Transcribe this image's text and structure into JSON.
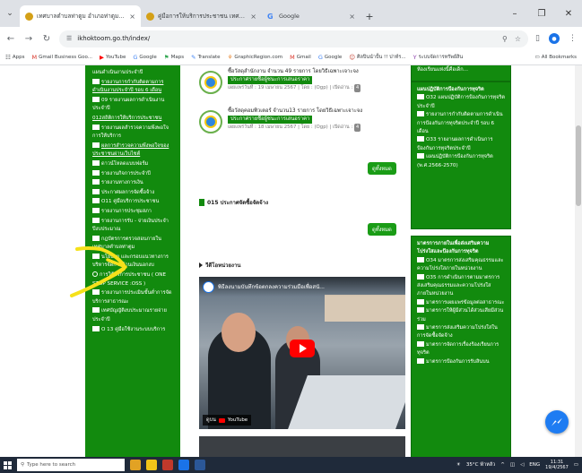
{
  "browser": {
    "tabs": [
      {
        "title": "เทศบาลตำบลท่าตูม อำเภอท่าตูม จังหวัด",
        "close": "×",
        "active": true,
        "favicon_color": "#d4a017"
      },
      {
        "title": "คู่มือการให้บริการประชาชน เทศบาลต",
        "close": "×",
        "active": false,
        "favicon_color": "#d4a017"
      },
      {
        "title": "Google",
        "close": "×",
        "active": false,
        "favicon_text": "G"
      }
    ],
    "new_tab": "+",
    "window_controls": [
      "–",
      "❐",
      "✕"
    ],
    "url": "ikhoktoom.go.th/index/",
    "bookmarks": [
      {
        "icon": "☷",
        "label": "Apps"
      },
      {
        "icon": "M",
        "label": "Gmail Business Goo..."
      },
      {
        "icon": "▶",
        "label": "YouTube"
      },
      {
        "icon": "G",
        "label": "Google"
      },
      {
        "icon": "⚑",
        "label": "Maps"
      },
      {
        "icon": "✎",
        "label": "Translate"
      },
      {
        "icon": "⚘",
        "label": "GraphicRegion.com"
      },
      {
        "icon": "M",
        "label": "Gmail"
      },
      {
        "icon": "G",
        "label": "Google"
      },
      {
        "icon": "☺",
        "label": "ศิลปินนำปั้น !! ปาท์ร..."
      },
      {
        "icon": "Y",
        "label": "ระบบจัดการทรัพย์สิน"
      }
    ],
    "all_bookmarks": "All Bookmarks"
  },
  "left_panel": {
    "items": [
      {
        "text": "แผนดำเนินงานประจำปี",
        "style": "plain"
      },
      {
        "text": "รายงานการกำกับติดตามการดำเนินงานประจำปี รอบ 6 เดือน",
        "style": "doc-underline"
      },
      {
        "text": "09 รายงานผลการดำเนินงานประจำปี",
        "style": "doc"
      },
      {
        "text": "012สถิติการให้บริการประชาชน",
        "style": "underline"
      },
      {
        "text": "รายงานผลสำรวจความพึงพอใจการให้บริการ",
        "style": "doc"
      },
      {
        "text": "ผลการสำรวจความพึงพอใจของประชาชนผ่านเว็บไซต์",
        "style": "doc-underline"
      },
      {
        "text": "ดาวน์โหลดแบบฟอร์ม",
        "style": "doc"
      },
      {
        "text": "รายงานกิจการประจำปี",
        "style": "doc"
      },
      {
        "text": "รายงานทางการเงิน",
        "style": "doc"
      },
      {
        "text": "ประกาศผลการจัดซื้อจ้าง",
        "style": "doc"
      },
      {
        "text": "O11 คู่มือบริการประชาชน",
        "style": "doc"
      },
      {
        "text": "รายงานการประชุมสภา",
        "style": "doc"
      },
      {
        "text": "รายงานการรับ - จ่ายเงินประจำปีงบประมาณ",
        "style": "doc"
      },
      {
        "text": "กฎบัตรการตรวจสอบภายในเทศบาลตำบลท่าตูม",
        "style": "doc"
      },
      {
        "text": "นโยบาย และกรอบแนวทางการบริหารจัดการด้านเงินนอกงบ",
        "style": "doc"
      },
      {
        "text": "การให้บริการประชาชน ( ONE STOP SERVICE :OSS )",
        "style": "bullet"
      },
      {
        "text": "รายงานการประเมินขั้นต่ำการจัดบริการสาธารณะ",
        "style": "doc"
      },
      {
        "text": "เทศบัญญัติงบประมาณรายจ่ายประจำปี",
        "style": "doc"
      },
      {
        "text": "O 13 คู่มือใช้งานระบบบริการ",
        "style": "doc"
      }
    ]
  },
  "center": {
    "news": [
      {
        "title": "ซื้อวัสดุสำนักงาน จำนวน 49 รายการ โดยวิธีเฉพาะเจาะจง",
        "tag": "ประกาศรายชื่อผู้ชนะการเสนอราคา",
        "meta": "เผยแพร่วันที่ : 19 เมษายน 2567 | โดย : (Ogp) | เปิดอ่าน :",
        "count": "4"
      },
      {
        "title": "ซื้อวัสดุคอมพิวเตอร์ จำนวน13 รายการ โดยวิธีเฉพาะเจาะจง",
        "tag": "ประกาศรายชื่อผู้ชนะการเสนอราคา",
        "meta": "เผยแพร่วันที่ : 18 เมษายน 2567 | โดย : (Ogp) | เปิดอ่าน :",
        "count": "4"
      }
    ],
    "view_all_1": "ดูทั้งหมด",
    "section_procurement": "015 ประกาศจัดซื้อจัดจ้าง",
    "view_all_2": "ดูทั้งหมด",
    "section_video": "วีดีโอหน่วยงาน",
    "video": {
      "title": "พิธีลงนามบันทึกข้อตกลงความร่วมมือเพื่อสนั...",
      "watch_on": "ดูบน",
      "watch_on_brand": "YouTube"
    }
  },
  "right_panel": {
    "box1": {
      "items": [
        {
          "text": "ห้องเรียนแห่งนี้คือเด็ก...",
          "style": "plain"
        }
      ]
    },
    "box2": {
      "title": "แผนปฏิบัติการป้องกันการทุจริต",
      "items": [
        {
          "text": "O32 แผนปฏิบัติการป้องกันการทุจริตประจำปี",
          "style": "doc"
        },
        {
          "text": "รายงานการกำกับติดตามการดำเนินการป้องกันการทุจริตประจำปี รอบ 6 เดือน",
          "style": "doc"
        },
        {
          "text": "O33 รายงานผลการดำเนินการป้องกันการทุจริตประจำปี",
          "style": "doc"
        },
        {
          "text": "แผนปฏิบัติการป้องกันการทุจริต (พ.ศ.2566-2570)",
          "style": "doc"
        }
      ]
    },
    "box3": {
      "title": "มาตรการภายในเพื่อส่งเสริมความโปร่งใสและป้องกันการทุจริต",
      "items": [
        {
          "text": "O34 มาตรการส่งเสริมคุณธรรมและความโปร่งใสภายในหน่วยงาน",
          "style": "doc"
        },
        {
          "text": "O35 การดำเนินการตามมาตรการส่งเสริมคุณธรรมและความโปร่งใสภายในหน่วยงาน",
          "style": "doc"
        },
        {
          "text": "มาตรการเผยแพร่ข้อมูลต่อสาธารณะ",
          "style": "doc"
        },
        {
          "text": "มาตรการให้ผู้มีส่วนได้ส่วนเสียมีส่วนร่วม",
          "style": "doc"
        },
        {
          "text": "มาตรการส่งเสริมความโปร่งใสในการจัดซื้อจัดจ้าง",
          "style": "doc"
        },
        {
          "text": "มาตรการจัดการเรื่องร้องเรียนการทุจริต",
          "style": "doc"
        },
        {
          "text": "มาตรการป้องกันการรับสินบน",
          "style": "doc"
        }
      ]
    }
  },
  "taskbar": {
    "search_placeholder": "Type here to search",
    "weather": "35°C ฟ้าหลัว",
    "lang": "ENG",
    "time": "11:31",
    "date": "19/4/2567"
  },
  "colors": {
    "panel_green": "#128a0e",
    "button_green": "#1a9c16",
    "annotation_yellow": "#f5e11a",
    "messenger_blue": "#1e7cf2"
  },
  "icons": {
    "menu": "chevron-down-icon",
    "back": "arrow-left-icon",
    "forward": "arrow-right-icon",
    "reload": "reload-icon",
    "zoom": "zoom-icon",
    "star": "bookmark-star-icon",
    "messenger": "messenger-icon"
  }
}
